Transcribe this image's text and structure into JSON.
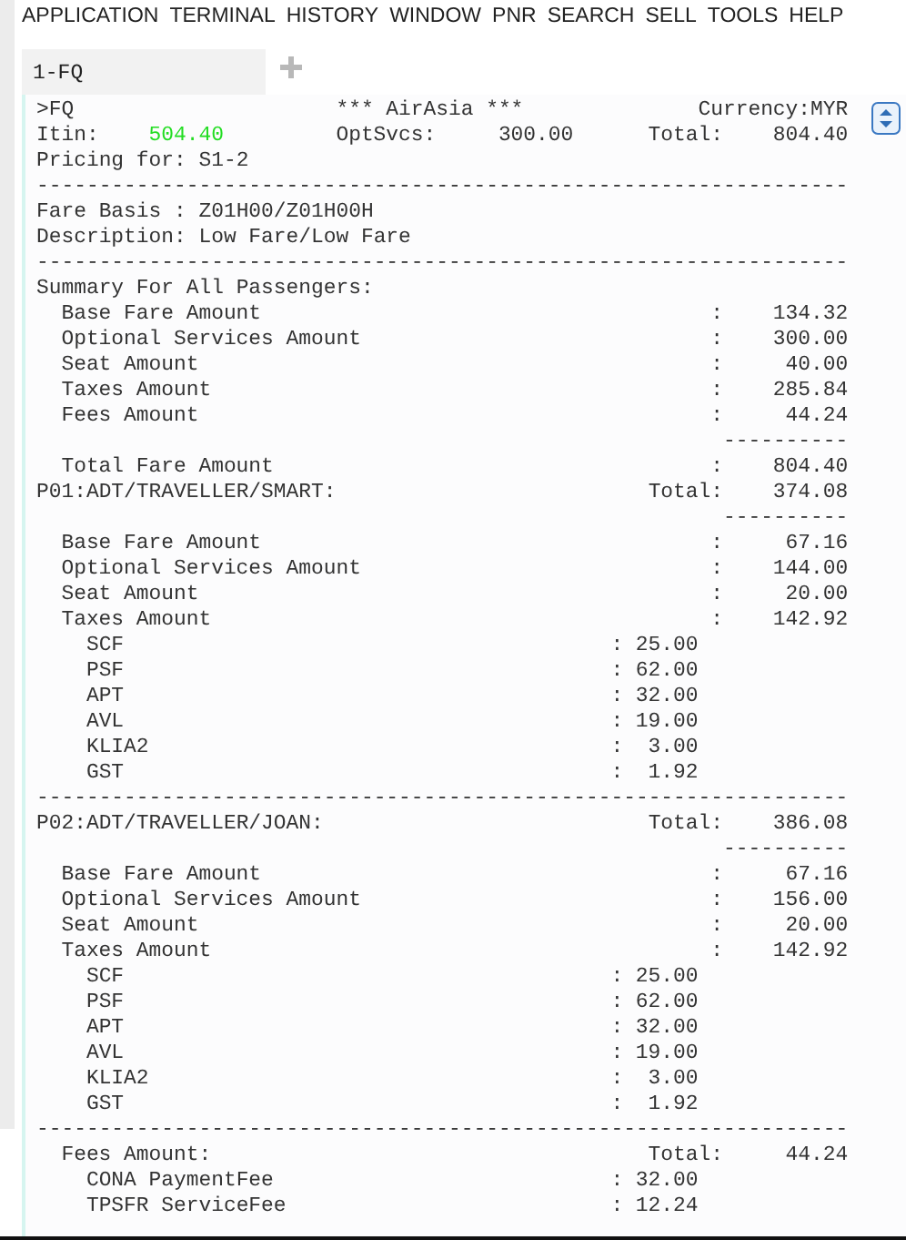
{
  "menu": [
    "APPLICATION",
    "TERMINAL",
    "HISTORY",
    "WINDOW",
    "PNR",
    "SEARCH",
    "SELL",
    "TOOLS",
    "HELP"
  ],
  "tabs": [
    {
      "label": "1-FQ",
      "selected": true
    }
  ],
  "header": {
    "command": ">FQ",
    "carrier": "*** AirAsia ***",
    "currency": "Currency:MYR",
    "itin": {
      "label": "Itin:",
      "value": "504.40",
      "highlighted": true
    },
    "opt": {
      "label": "OptSvcs:",
      "value": "300.00"
    },
    "total": {
      "label": "Total:",
      "value": "804.40"
    }
  },
  "lines": [
    {
      "kind": "text",
      "text": "Pricing for: S1-2"
    },
    {
      "kind": "rule",
      "text": "-----------------------------------------------------------------"
    },
    {
      "kind": "text",
      "text": "Fare Basis : Z01H00/Z01H00H"
    },
    {
      "kind": "text",
      "text": "Description: Low Fare/Low Fare"
    },
    {
      "kind": "rule",
      "text": "-----------------------------------------------------------------"
    },
    {
      "kind": "text",
      "text": "Summary For All Passengers:"
    },
    {
      "kind": "amount",
      "label": "Base Fare Amount",
      "sep": ":",
      "value": "134.32"
    },
    {
      "kind": "amount",
      "label": "Optional Services Amount",
      "sep": ":",
      "value": "300.00"
    },
    {
      "kind": "amount",
      "label": "Seat Amount",
      "sep": ":",
      "value": "40.00"
    },
    {
      "kind": "amount",
      "label": "Taxes Amount",
      "sep": ":",
      "value": "285.84"
    },
    {
      "kind": "amount",
      "label": "Fees Amount",
      "sep": ":",
      "value": "44.24"
    },
    {
      "kind": "subrule",
      "text": "----------"
    },
    {
      "kind": "amount",
      "label": "Total Fare Amount",
      "sep": ":",
      "value": "804.40"
    },
    {
      "kind": "passenger",
      "label": "P01:ADT/TRAVELLER/SMART:",
      "total_label": "Total:",
      "value": "374.08"
    },
    {
      "kind": "subrule",
      "text": "----------"
    },
    {
      "kind": "amount",
      "label": "Base Fare Amount",
      "sep": ":",
      "value": "67.16"
    },
    {
      "kind": "amount",
      "label": "Optional Services Amount",
      "sep": ":",
      "value": "144.00"
    },
    {
      "kind": "amount",
      "label": "Seat Amount",
      "sep": ":",
      "value": "20.00"
    },
    {
      "kind": "amount",
      "label": "Taxes Amount",
      "sep": ":",
      "value": "142.92"
    },
    {
      "kind": "item",
      "label": "SCF",
      "sep": ":",
      "value": "25.00"
    },
    {
      "kind": "item",
      "label": "PSF",
      "sep": ":",
      "value": "62.00"
    },
    {
      "kind": "item",
      "label": "APT",
      "sep": ":",
      "value": "32.00"
    },
    {
      "kind": "item",
      "label": "AVL",
      "sep": ":",
      "value": "19.00"
    },
    {
      "kind": "item",
      "label": "KLIA2",
      "sep": ":",
      "value": "3.00"
    },
    {
      "kind": "item",
      "label": "GST",
      "sep": ":",
      "value": "1.92"
    },
    {
      "kind": "rule",
      "text": "-----------------------------------------------------------------"
    },
    {
      "kind": "passenger",
      "label": "P02:ADT/TRAVELLER/JOAN:",
      "total_label": "Total:",
      "value": "386.08"
    },
    {
      "kind": "subrule",
      "text": "----------"
    },
    {
      "kind": "amount",
      "label": "Base Fare Amount",
      "sep": ":",
      "value": "67.16"
    },
    {
      "kind": "amount",
      "label": "Optional Services Amount",
      "sep": ":",
      "value": "156.00"
    },
    {
      "kind": "amount",
      "label": "Seat Amount",
      "sep": ":",
      "value": "20.00"
    },
    {
      "kind": "amount",
      "label": "Taxes Amount",
      "sep": ":",
      "value": "142.92"
    },
    {
      "kind": "item",
      "label": "SCF",
      "sep": ":",
      "value": "25.00"
    },
    {
      "kind": "item",
      "label": "PSF",
      "sep": ":",
      "value": "62.00"
    },
    {
      "kind": "item",
      "label": "APT",
      "sep": ":",
      "value": "32.00"
    },
    {
      "kind": "item",
      "label": "AVL",
      "sep": ":",
      "value": "19.00"
    },
    {
      "kind": "item",
      "label": "KLIA2",
      "sep": ":",
      "value": "3.00"
    },
    {
      "kind": "item",
      "label": "GST",
      "sep": ":",
      "value": "1.92"
    },
    {
      "kind": "rule",
      "text": "-----------------------------------------------------------------"
    },
    {
      "kind": "section",
      "label": "Fees Amount:",
      "total_label": "Total:",
      "value": "44.24"
    },
    {
      "kind": "item",
      "label": "CONA PaymentFee",
      "sep": ":",
      "value": "32.00"
    },
    {
      "kind": "item",
      "label": "TPSFR ServiceFee",
      "sep": ":",
      "value": "12.24"
    }
  ]
}
